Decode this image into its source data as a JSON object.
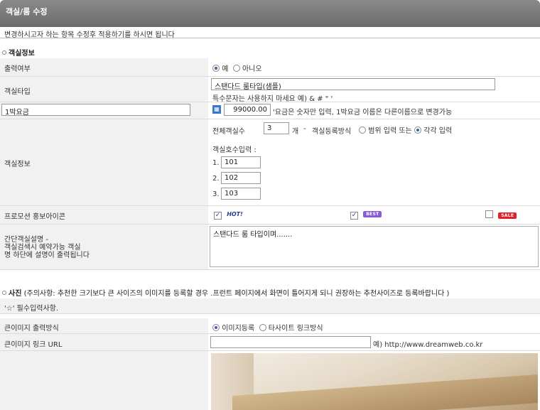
{
  "header": {
    "title": "객실/룸 수정",
    "subtitle": "변경하시고자 하는 항목 수정후 적용하기를 하시면 됩니다"
  },
  "room_info": {
    "section_title": "객실정보",
    "output": {
      "label": "출력여부",
      "opt_yes": "예",
      "opt_no": "아니오"
    },
    "type": {
      "label": "객실타입",
      "value": "스탠다드 룸타입(샘플)",
      "note": "특수문자는 사용하지 마세요 예) & # \" '"
    },
    "price": {
      "label_value": "1박요금",
      "price_value": "99000.00",
      "note": "'요금은 숫자만 입력, 1박요금 이름은 다른이름으로 변경가능"
    },
    "info": {
      "label": "객실정보",
      "total_label": "전체객실수",
      "total_value": "3",
      "unit": "개",
      "dash": "-",
      "method_label": "객실등록방식",
      "opt_range": "범위 입력 또는",
      "opt_each": "각각 입력",
      "room_no_label": "객실호수입력 :",
      "rooms": [
        {
          "idx": "1.",
          "value": "101"
        },
        {
          "idx": "2.",
          "value": "102"
        },
        {
          "idx": "3.",
          "value": "103"
        }
      ]
    },
    "promo": {
      "label": "프로모션 홍보아이콘",
      "hot": "HOT!",
      "best": "BEST",
      "sale": "SALE"
    },
    "desc": {
      "label_line1": "간단객실설명 -",
      "label_line2": "객실검색시 예약가능 객실",
      "label_line3": "명 하단에 설명이 출력됩니다",
      "value": "스탠다드 룸 타입이며......."
    }
  },
  "photo": {
    "section_title": "사진",
    "section_note": "(주의사항: 추천한 크기보다 큰 사이즈의 이미지를 등록할 경우 .프런트 페이지에서 화면이 틀어지게 되니 권장하는 추천사이즈로 등록바랍니다 )",
    "required_note": "'☆' 필수입력사항.",
    "output_method": {
      "label": "큰이미지 출력방식",
      "opt_upload": "이미지등록",
      "opt_link": "타사이트 링크방식"
    },
    "link_url": {
      "label": "큰이미지 링크 URL",
      "value": "",
      "example": "예) http://www.dreamweb.co.kr"
    }
  },
  "colors": {
    "title_bar": "#7a7a7a",
    "label_bg": "#f1f1f1",
    "sale": "#e0202a",
    "best": "#8a5ad6",
    "hot": "#2b3d8a"
  }
}
